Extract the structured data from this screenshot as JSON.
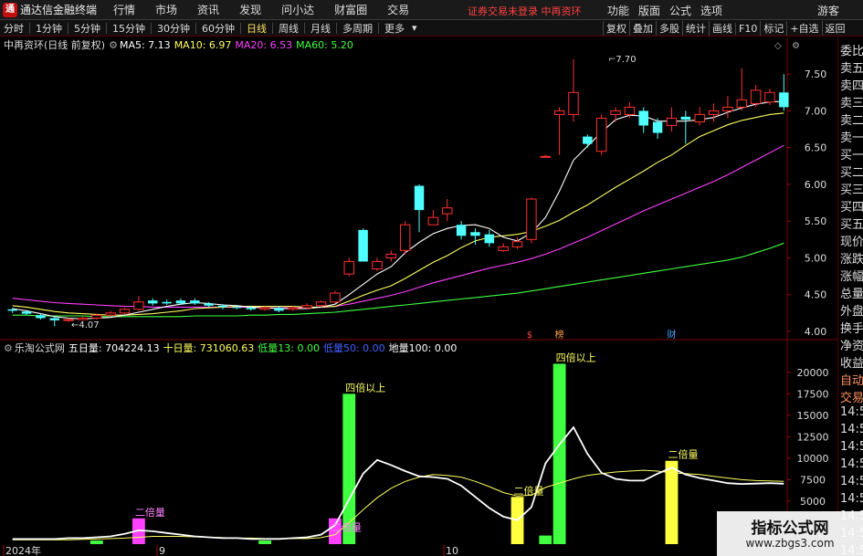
{
  "titlebar": {
    "logo": "通",
    "app_title": "通达信金融终端",
    "menus": [
      "行情",
      "市场",
      "资讯",
      "发现",
      "问小达",
      "财富圈",
      "交易"
    ],
    "warning": "证券交易未登录  中再资环",
    "right_menus": [
      "功能",
      "版面",
      "公式",
      "选项"
    ],
    "guest": "游客"
  },
  "toolbar": {
    "periods": [
      "分时",
      "1分钟",
      "5分钟",
      "15分钟",
      "30分钟",
      "60分钟",
      "日线",
      "周线",
      "月线",
      "多周期",
      "更多"
    ],
    "active": "日线",
    "right_tools": [
      "复权",
      "叠加",
      "多股",
      "统计",
      "画线",
      "F10",
      "标记",
      "+自选",
      "返回"
    ]
  },
  "main": {
    "title": "中再资环(日线 前复权)",
    "ma": [
      {
        "label": "MA5: 7.13",
        "color": "#ffffff"
      },
      {
        "label": "MA10: 6.97",
        "color": "#ffff60"
      },
      {
        "label": "MA20: 6.53",
        "color": "#ff40ff"
      },
      {
        "label": "MA60: 5.20",
        "color": "#40ff40"
      }
    ],
    "high_label": "7.70",
    "low_label": "4.07",
    "markers": [
      "$",
      "榜",
      "财"
    ]
  },
  "vol": {
    "title": "乐淘公式网",
    "items": [
      {
        "label": "五日量: 704224.13",
        "color": "#ffffff"
      },
      {
        "label": "十日量: 731060.63",
        "color": "#ffff60"
      },
      {
        "label": "低量13: 0.00",
        "color": "#40ff40"
      },
      {
        "label": "低量50: 0.00",
        "color": "#4060ff"
      },
      {
        "label": "地量100: 0.00",
        "color": "#ffffff"
      }
    ],
    "labels": [
      "二倍量",
      "四倍以上",
      "二倍量",
      "四倍以上",
      "二倍量",
      "四倍以上",
      "二倍量"
    ]
  },
  "price_axis": [
    "7.50",
    "7.00",
    "6.50",
    "6.00",
    "5.50",
    "5.00",
    "4.50",
    "4.00"
  ],
  "vol_axis": [
    "20000",
    "17500",
    "15000",
    "12500",
    "10000",
    "7500",
    "5000"
  ],
  "date_axis": [
    "2024年",
    "9",
    "10"
  ],
  "side": [
    "委比",
    "卖五",
    "卖四",
    "卖三",
    "卖二",
    "卖一",
    "买一",
    "买二",
    "买三",
    "买四",
    "买五",
    "现价",
    "涨跌",
    "涨幅",
    "总量",
    "外盘",
    "换手",
    "净资",
    "收益",
    "自动",
    "交易",
    "14:56",
    "14:56",
    "14:56",
    "14:56",
    "14:56",
    "14:56",
    "14:56",
    "14:56",
    "14:56"
  ],
  "chart_data": {
    "type": "candlestick",
    "candles": [
      [
        4.3,
        4.28,
        4.32,
        4.25
      ],
      [
        4.27,
        4.24,
        4.29,
        4.22
      ],
      [
        4.22,
        4.18,
        4.24,
        4.16
      ],
      [
        4.18,
        4.15,
        4.2,
        4.07
      ],
      [
        4.15,
        4.16,
        4.18,
        4.13
      ],
      [
        4.16,
        4.18,
        4.2,
        4.15
      ],
      [
        4.18,
        4.22,
        4.24,
        4.16
      ],
      [
        4.22,
        4.25,
        4.28,
        4.2
      ],
      [
        4.25,
        4.3,
        4.32,
        4.23
      ],
      [
        4.3,
        4.4,
        4.48,
        4.28
      ],
      [
        4.42,
        4.38,
        4.45,
        4.35
      ],
      [
        4.4,
        4.38,
        4.43,
        4.36
      ],
      [
        4.42,
        4.38,
        4.45,
        4.36
      ],
      [
        4.42,
        4.38,
        4.45,
        4.36
      ],
      [
        4.38,
        4.35,
        4.4,
        4.33
      ],
      [
        4.35,
        4.33,
        4.37,
        4.3
      ],
      [
        4.33,
        4.32,
        4.36,
        4.3
      ],
      [
        4.32,
        4.3,
        4.35,
        4.28
      ],
      [
        4.3,
        4.32,
        4.34,
        4.28
      ],
      [
        4.32,
        4.28,
        4.34,
        4.26
      ],
      [
        4.3,
        4.32,
        4.35,
        4.28
      ],
      [
        4.32,
        4.35,
        4.38,
        4.3
      ],
      [
        4.35,
        4.4,
        4.42,
        4.33
      ],
      [
        4.4,
        4.52,
        4.55,
        4.38
      ],
      [
        4.78,
        4.95,
        5.0,
        4.75
      ],
      [
        5.38,
        4.95,
        5.4,
        4.95
      ],
      [
        4.85,
        4.95,
        5.0,
        4.82
      ],
      [
        5.0,
        5.05,
        5.1,
        4.95
      ],
      [
        5.1,
        5.45,
        5.5,
        5.05
      ],
      [
        5.98,
        5.65,
        6.0,
        5.35
      ],
      [
        5.45,
        5.55,
        5.65,
        5.45
      ],
      [
        5.6,
        5.68,
        5.8,
        5.5
      ],
      [
        5.45,
        5.3,
        5.5,
        5.25
      ],
      [
        5.35,
        5.3,
        5.4,
        5.18
      ],
      [
        5.32,
        5.2,
        5.38,
        5.15
      ],
      [
        5.1,
        5.15,
        5.2,
        5.08
      ],
      [
        5.15,
        5.22,
        5.28,
        5.12
      ],
      [
        5.25,
        5.8,
        5.82,
        5.2
      ],
      [
        6.38,
        6.38,
        6.4,
        6.38
      ],
      [
        6.95,
        7.0,
        7.05,
        6.4
      ],
      [
        6.95,
        7.25,
        7.7,
        6.85
      ],
      [
        6.65,
        6.55,
        6.68,
        6.5
      ],
      [
        6.45,
        6.9,
        6.95,
        6.4
      ],
      [
        6.95,
        7.0,
        7.05,
        6.85
      ],
      [
        6.95,
        7.05,
        7.12,
        6.9
      ],
      [
        7.0,
        6.8,
        7.05,
        6.7
      ],
      [
        6.85,
        6.7,
        6.9,
        6.62
      ],
      [
        6.8,
        6.9,
        7.05,
        6.72
      ],
      [
        6.92,
        6.88,
        7.0,
        6.55
      ],
      [
        6.85,
        6.95,
        7.05,
        6.8
      ],
      [
        6.95,
        7.0,
        7.1,
        6.85
      ],
      [
        7.0,
        7.05,
        7.2,
        6.9
      ],
      [
        7.05,
        7.15,
        7.58,
        7.0
      ],
      [
        7.1,
        7.28,
        7.35,
        7.05
      ],
      [
        7.12,
        7.25,
        7.3,
        7.08
      ],
      [
        7.25,
        7.05,
        7.5,
        7.0
      ]
    ],
    "ma5": [
      4.31,
      4.28,
      4.24,
      4.2,
      4.18,
      4.17,
      4.18,
      4.19,
      4.22,
      4.26,
      4.3,
      4.34,
      4.37,
      4.39,
      4.38,
      4.36,
      4.35,
      4.33,
      4.32,
      4.31,
      4.31,
      4.31,
      4.33,
      4.37,
      4.5,
      4.64,
      4.78,
      4.88,
      5.07,
      5.21,
      5.33,
      5.4,
      5.44,
      5.45,
      5.4,
      5.28,
      5.23,
      5.34,
      5.55,
      5.91,
      6.33,
      6.52,
      6.71,
      6.88,
      6.94,
      6.93,
      6.86,
      6.86,
      6.86,
      6.88,
      6.91,
      6.98,
      7.04,
      7.09,
      7.12,
      7.13
    ],
    "ma10": [
      4.35,
      4.33,
      4.3,
      4.27,
      4.25,
      4.24,
      4.23,
      4.22,
      4.22,
      4.23,
      4.24,
      4.26,
      4.28,
      4.31,
      4.32,
      4.33,
      4.34,
      4.34,
      4.34,
      4.34,
      4.34,
      4.33,
      4.33,
      4.34,
      4.41,
      4.49,
      4.56,
      4.62,
      4.72,
      4.83,
      4.94,
      5.03,
      5.14,
      5.23,
      5.28,
      5.3,
      5.32,
      5.36,
      5.43,
      5.51,
      5.62,
      5.72,
      5.84,
      5.96,
      6.07,
      6.18,
      6.3,
      6.4,
      6.53,
      6.65,
      6.73,
      6.81,
      6.87,
      6.91,
      6.95,
      6.97
    ],
    "ma20": [
      4.45,
      4.43,
      4.41,
      4.39,
      4.38,
      4.37,
      4.36,
      4.35,
      4.34,
      4.34,
      4.33,
      4.33,
      4.33,
      4.33,
      4.33,
      4.33,
      4.33,
      4.33,
      4.32,
      4.32,
      4.32,
      4.32,
      4.33,
      4.34,
      4.37,
      4.41,
      4.45,
      4.49,
      4.54,
      4.6,
      4.66,
      4.71,
      4.76,
      4.81,
      4.86,
      4.9,
      4.94,
      4.99,
      5.05,
      5.12,
      5.2,
      5.28,
      5.37,
      5.46,
      5.55,
      5.64,
      5.72,
      5.8,
      5.88,
      5.96,
      6.04,
      6.13,
      6.23,
      6.33,
      6.43,
      6.53
    ],
    "ma60": [
      4.22,
      4.22,
      4.21,
      4.21,
      4.21,
      4.21,
      4.2,
      4.2,
      4.2,
      4.2,
      4.2,
      4.2,
      4.2,
      4.21,
      4.21,
      4.21,
      4.21,
      4.22,
      4.22,
      4.23,
      4.23,
      4.24,
      4.25,
      4.26,
      4.28,
      4.3,
      4.32,
      4.34,
      4.36,
      4.38,
      4.4,
      4.42,
      4.44,
      4.46,
      4.48,
      4.5,
      4.52,
      4.55,
      4.58,
      4.61,
      4.64,
      4.67,
      4.7,
      4.73,
      4.76,
      4.79,
      4.82,
      4.85,
      4.88,
      4.91,
      4.94,
      4.97,
      5.01,
      5.07,
      5.13,
      5.2
    ],
    "volume": {
      "bars": [
        {
          "i": 9,
          "v": 3000,
          "color": "#ff40ff"
        },
        {
          "i": 23,
          "v": 3000,
          "color": "#ff40ff"
        },
        {
          "i": 24,
          "v": 17500,
          "color": "#40ff40"
        },
        {
          "i": 36,
          "v": 5500,
          "color": "#ffff40"
        },
        {
          "i": 38,
          "v": 1000,
          "color": "#40ff40"
        },
        {
          "i": 39,
          "v": 21000,
          "color": "#40ff40"
        },
        {
          "i": 47,
          "v": 9700,
          "color": "#ffff40"
        }
      ],
      "ma5": [
        600,
        600,
        600,
        600,
        700,
        700,
        800,
        900,
        1200,
        1600,
        1500,
        1300,
        1100,
        900,
        800,
        700,
        700,
        600,
        600,
        600,
        700,
        800,
        1100,
        2200,
        5200,
        8200,
        9800,
        9200,
        8500,
        7900,
        7800,
        7600,
        6800,
        5500,
        4200,
        3200,
        2800,
        4300,
        9400,
        11600,
        13600,
        10500,
        8300,
        7600,
        7400,
        7400,
        8200,
        8900,
        8100,
        7700,
        7400,
        7100,
        7000,
        7050,
        7100,
        7040
      ],
      "ma10": [
        500,
        500,
        500,
        500,
        500,
        550,
        600,
        650,
        700,
        800,
        900,
        900,
        900,
        850,
        800,
        750,
        700,
        700,
        650,
        650,
        650,
        650,
        750,
        1100,
        2500,
        4000,
        5400,
        6500,
        7300,
        7800,
        8100,
        8000,
        7800,
        7300,
        6700,
        6000,
        5600,
        5700,
        6600,
        7100,
        7600,
        8000,
        8200,
        8400,
        8500,
        8600,
        8500,
        8300,
        8200,
        8100,
        7900,
        7700,
        7500,
        7400,
        7350,
        7310
      ]
    },
    "price_ylim": [
      3.9,
      7.8
    ],
    "vol_ylim": [
      0,
      22000
    ]
  }
}
